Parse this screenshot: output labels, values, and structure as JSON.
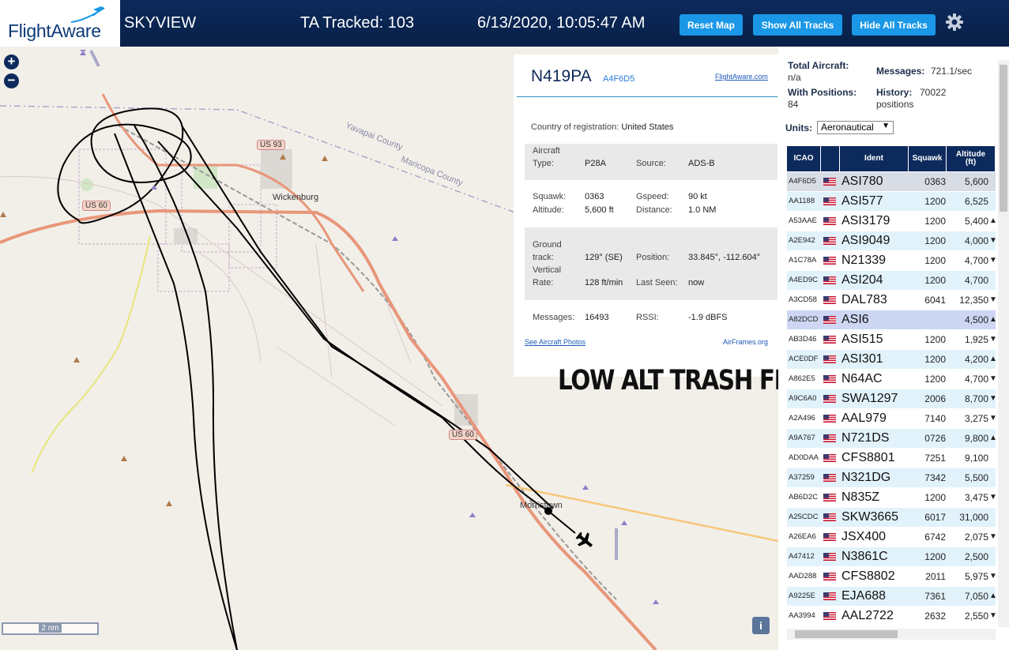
{
  "header": {
    "logo": "FlightAware",
    "site_name": "SKYVIEW",
    "tracked": "TA Tracked: 103",
    "datetime": "6/13/2020, 10:05:47 AM",
    "buttons": {
      "reset": "Reset Map",
      "show_all": "Show All Tracks",
      "hide_all": "Hide All Tracks"
    },
    "settings_icon": "gear-icon"
  },
  "map": {
    "scale": "2 nm",
    "info_button": "i",
    "zoom_in": "+",
    "zoom_out": "−",
    "labels": {
      "wickenburg": "Wickenburg",
      "morristown": "Morristown",
      "us93": "US 93",
      "us60a": "US 60",
      "us60b": "US 60",
      "yavapai": "Yavapai County",
      "maricopa": "Maricopa County"
    },
    "annotation": "LOW ALT TRASH FROM KDVT"
  },
  "aircraft": {
    "registration": "N419PA",
    "hex": "A4F6D5",
    "fa_link": "FlightAware.com",
    "country_label": "Country of registration:",
    "country_value": "United States",
    "aircraft_type_label": "Aircraft Type:",
    "aircraft_type_value": "P28A",
    "source_label": "Source:",
    "source_value": "ADS-B",
    "squawk_label": "Squawk:",
    "squawk_value": "0363",
    "gspeed_label": "Gspeed:",
    "gspeed_value": "90 kt",
    "altitude_label": "Altitude:",
    "altitude_value": "5,600 ft",
    "distance_label": "Distance:",
    "distance_value": "1.0 NM",
    "ground_track_label": "Ground track:",
    "ground_track_value": "129° (SE)",
    "position_label": "Position:",
    "position_value": "33.845°, -112.604°",
    "vrate_label": "Vertical Rate:",
    "vrate_value": "128 ft/min",
    "last_seen_label": "Last Seen:",
    "last_seen_value": "now",
    "messages_label": "Messages:",
    "messages_value": "16493",
    "rssi_label": "RSSI:",
    "rssi_value": "-1.9 dBFS",
    "photos_link": "See Aircraft Photos",
    "airframes_link": "AirFrames.org"
  },
  "sidebar": {
    "total_aircraft_label": "Total Aircraft:",
    "total_aircraft_value": "n/a",
    "messages_label": "Messages:",
    "messages_value": "721.1/sec",
    "with_positions_label": "With Positions:",
    "with_positions_value": "84",
    "history_label": "History:",
    "history_value": "70022 positions",
    "units_label": "Units:",
    "units_value": "Aeronautical"
  },
  "table": {
    "headers": {
      "icao": "ICAO",
      "ident": "Ident",
      "squawk": "Squawk",
      "altitude": "Altitude (ft)"
    },
    "rows": [
      {
        "icao": "A4F6D5",
        "ident": "ASI780",
        "squawk": "0363",
        "altitude": "5,600",
        "trend": ""
      },
      {
        "icao": "AA1188",
        "ident": "ASI577",
        "squawk": "1200",
        "altitude": "6,525",
        "trend": ""
      },
      {
        "icao": "A53AAE",
        "ident": "ASI3179",
        "squawk": "1200",
        "altitude": "5,400",
        "trend": "▲"
      },
      {
        "icao": "A2E942",
        "ident": "ASI9049",
        "squawk": "1200",
        "altitude": "4,000",
        "trend": "▼"
      },
      {
        "icao": "A1C78A",
        "ident": "N21339",
        "squawk": "1200",
        "altitude": "4,700",
        "trend": "▼"
      },
      {
        "icao": "A4ED9C",
        "ident": "ASI204",
        "squawk": "1200",
        "altitude": "4,700",
        "trend": ""
      },
      {
        "icao": "A3CD58",
        "ident": "DAL783",
        "squawk": "6041",
        "altitude": "12,350",
        "trend": "▼"
      },
      {
        "icao": "A82DCD",
        "ident": "ASI6",
        "squawk": "",
        "altitude": "4,500",
        "trend": "▲"
      },
      {
        "icao": "AB3D46",
        "ident": "ASI515",
        "squawk": "1200",
        "altitude": "1,925",
        "trend": "▼"
      },
      {
        "icao": "ACE0DF",
        "ident": "ASI301",
        "squawk": "1200",
        "altitude": "4,200",
        "trend": "▲"
      },
      {
        "icao": "A862E5",
        "ident": "N64AC",
        "squawk": "1200",
        "altitude": "4,700",
        "trend": "▼"
      },
      {
        "icao": "A9C6A0",
        "ident": "SWA1297",
        "squawk": "2006",
        "altitude": "8,700",
        "trend": "▼"
      },
      {
        "icao": "A2A496",
        "ident": "AAL979",
        "squawk": "7140",
        "altitude": "3,275",
        "trend": "▼"
      },
      {
        "icao": "A9A767",
        "ident": "N721DS",
        "squawk": "0726",
        "altitude": "9,800",
        "trend": "▲"
      },
      {
        "icao": "AD0DAA",
        "ident": "CFS8801",
        "squawk": "7251",
        "altitude": "9,100",
        "trend": ""
      },
      {
        "icao": "A37259",
        "ident": "N321DG",
        "squawk": "7342",
        "altitude": "5,500",
        "trend": ""
      },
      {
        "icao": "AB6D2C",
        "ident": "N835Z",
        "squawk": "1200",
        "altitude": "3,475",
        "trend": "▼"
      },
      {
        "icao": "A25CDC",
        "ident": "SKW3665",
        "squawk": "6017",
        "altitude": "31,000",
        "trend": ""
      },
      {
        "icao": "A26EA6",
        "ident": "JSX400",
        "squawk": "6742",
        "altitude": "2,075",
        "trend": "▼"
      },
      {
        "icao": "A47412",
        "ident": "N3861C",
        "squawk": "1200",
        "altitude": "2,500",
        "trend": ""
      },
      {
        "icao": "AAD288",
        "ident": "CFS8802",
        "squawk": "2011",
        "altitude": "5,975",
        "trend": "▼"
      },
      {
        "icao": "A9225E",
        "ident": "EJA688",
        "squawk": "7361",
        "altitude": "7,050",
        "trend": "▲"
      },
      {
        "icao": "AA3994",
        "ident": "AAL2722",
        "squawk": "2632",
        "altitude": "2,550",
        "trend": "▼"
      }
    ]
  },
  "colors": {
    "header_bg": "#0d2a5c",
    "button": "#1a97e6",
    "highway": "#e8967a",
    "track": "#000000"
  }
}
